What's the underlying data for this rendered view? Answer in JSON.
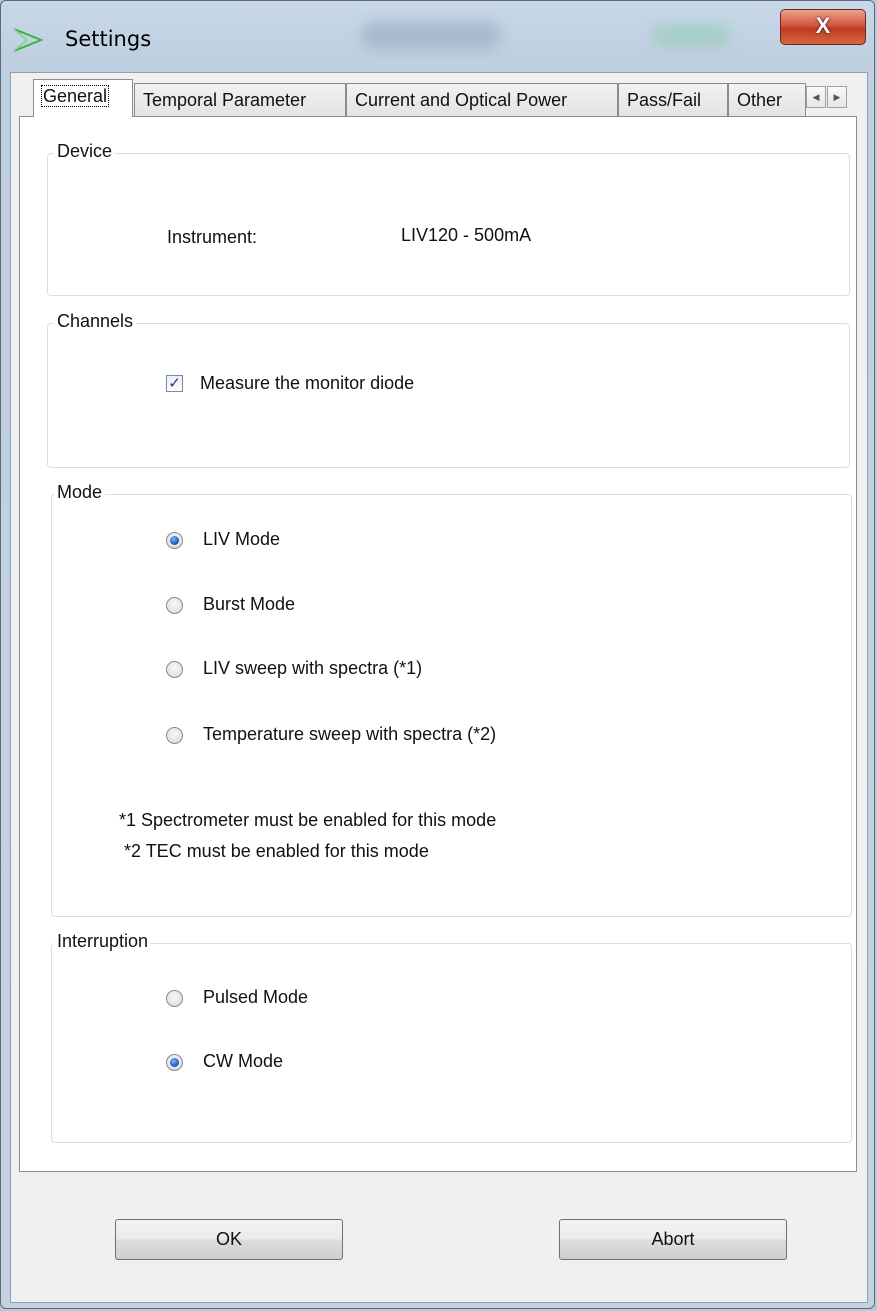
{
  "window": {
    "title": "Settings",
    "close_glyph": "X"
  },
  "tabs": [
    {
      "label": "General",
      "active": true
    },
    {
      "label": "Temporal Parameter",
      "active": false
    },
    {
      "label": "Current and Optical Power",
      "active": false
    },
    {
      "label": "Pass/Fail",
      "active": false
    },
    {
      "label": "Other",
      "active": false
    }
  ],
  "tab_scroll": {
    "left": "◀",
    "right": "▶"
  },
  "device": {
    "label": "Device",
    "instrument_label": "Instrument:",
    "instrument_value": "LIV120 - 500mA"
  },
  "channels": {
    "label": "Channels",
    "monitor_diode": {
      "label": "Measure the monitor diode",
      "checked": true,
      "check_glyph": "✓"
    }
  },
  "mode": {
    "label": "Mode",
    "options": [
      {
        "label": "LIV Mode",
        "checked": true
      },
      {
        "label": "Burst Mode",
        "checked": false
      },
      {
        "label": "LIV sweep with spectra (*1)",
        "checked": false
      },
      {
        "label": "Temperature sweep with spectra (*2)",
        "checked": false
      }
    ],
    "note1": "*1 Spectrometer must be enabled for this mode",
    "note2": "*2 TEC must be enabled for this mode"
  },
  "interruption": {
    "label": "Interruption",
    "options": [
      {
        "label": "Pulsed Mode",
        "checked": false
      },
      {
        "label": "CW Mode",
        "checked": true
      }
    ]
  },
  "buttons": {
    "ok": "OK",
    "abort": "Abort"
  },
  "colors": {
    "accent": "#1b5fc0",
    "close": "#c13a23"
  }
}
